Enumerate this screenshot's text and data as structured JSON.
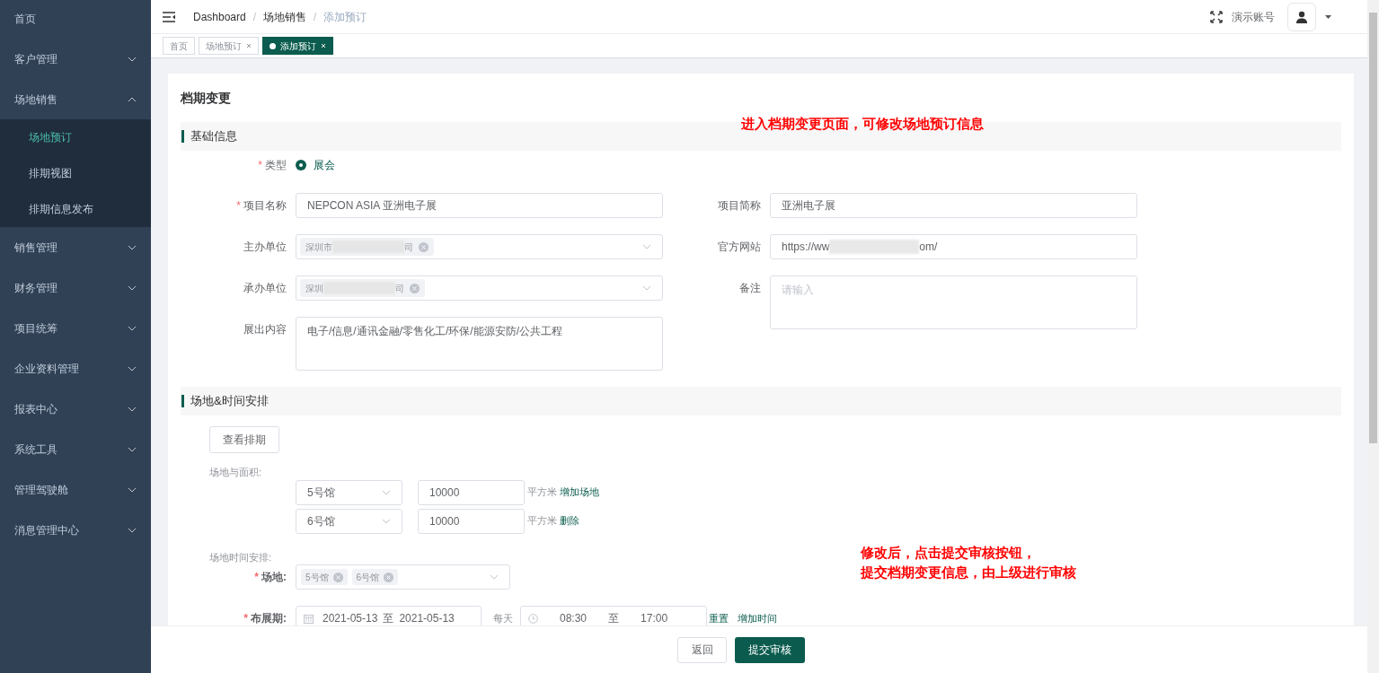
{
  "sidebar": {
    "items": [
      {
        "label": "首页"
      },
      {
        "label": "客户管理",
        "expandable": true,
        "expanded": false
      },
      {
        "label": "场地销售",
        "expandable": true,
        "expanded": true,
        "children": [
          {
            "label": "场地预订",
            "selected": true
          },
          {
            "label": "排期视图",
            "selected": false
          },
          {
            "label": "排期信息发布",
            "selected": false
          }
        ]
      },
      {
        "label": "销售管理",
        "expandable": true,
        "expanded": false
      },
      {
        "label": "财务管理",
        "expandable": true,
        "expanded": false
      },
      {
        "label": "项目统筹",
        "expandable": true,
        "expanded": false
      },
      {
        "label": "企业资料管理",
        "expandable": true,
        "expanded": false
      },
      {
        "label": "报表中心",
        "expandable": true,
        "expanded": false
      },
      {
        "label": "系统工具",
        "expandable": true,
        "expanded": false
      },
      {
        "label": "管理驾驶舱",
        "expandable": true,
        "expanded": false
      },
      {
        "label": "消息管理中心",
        "expandable": true,
        "expanded": false
      }
    ]
  },
  "header": {
    "breadcrumb": [
      {
        "label": "Dashboard",
        "current": false
      },
      {
        "separator": "/",
        "label": "场地销售",
        "current": false
      },
      {
        "separator": "/",
        "label": "添加预订",
        "current": true
      }
    ],
    "user": "演示账号"
  },
  "tabs": [
    {
      "label": "首页",
      "selected": false,
      "closable": false
    },
    {
      "label": "场地预订",
      "selected": false,
      "closable": true
    },
    {
      "label": "添加预订",
      "selected": true,
      "closable": true
    }
  ],
  "page_title": "档期变更",
  "basic_info": {
    "title": "基础信息",
    "type_field": {
      "label": "类型",
      "required_mark": "*",
      "option": {
        "label": "展会",
        "selected": true
      }
    },
    "left_fields": [
      {
        "kind": "input",
        "label": "项目名称",
        "required_mark": "*",
        "value": "NEPCON ASIA 亚洲电子展"
      },
      {
        "kind": "tag_select",
        "label": "主办单位",
        "tag": {
          "text_start": "深圳市",
          "text_end": "司"
        }
      },
      {
        "kind": "tag_select",
        "label": "承办单位",
        "tag": {
          "text_start": "深圳",
          "text_end": "司"
        }
      },
      {
        "kind": "textarea",
        "label": "展出内容",
        "value": "电子/信息/通讯金融/零售化工/环保/能源安防/公共工程"
      }
    ],
    "right_fields": [
      {
        "kind": "input",
        "label": "项目简称",
        "value": "亚洲电子展"
      },
      {
        "kind": "redacted_input",
        "label": "官方网站",
        "value_start": "https://ww",
        "value_end": "om/"
      },
      {
        "kind": "textarea",
        "label": "备注",
        "placeholder": "请输入"
      }
    ]
  },
  "venue_section": {
    "title": "场地&时间安排",
    "view_button": "查看排期",
    "area_label": "场地与面积:",
    "area_rows": [
      {
        "hall": "5号馆",
        "area": "10000",
        "unit": "平方米",
        "action": "增加场地"
      },
      {
        "hall": "6号馆",
        "area": "10000",
        "unit": "平方米",
        "action": "删除"
      }
    ],
    "schedule_label": "场地时间安排:",
    "venue_field": {
      "label": "场地:",
      "required_mark": "*",
      "tags": [
        "5号馆",
        "6号馆"
      ]
    },
    "setup_field": {
      "label": "布展期:",
      "required_mark": "*",
      "date_start": "2021-05-13",
      "date_sep": "至",
      "date_end": "2021-05-13",
      "daily": "每天",
      "time_start": "08:30",
      "time_sep": "至",
      "time_end": "17:00",
      "actions": [
        "重置",
        "增加时间"
      ]
    }
  },
  "footer_buttons": [
    {
      "label": "返回",
      "kind": "default"
    },
    {
      "label": "提交审核",
      "kind": "primary"
    }
  ],
  "annotations": [
    {
      "lines": [
        "进入档期变更页面，可修改场地预订信息"
      ]
    },
    {
      "lines": [
        "修改后，点击提交审核按钮，",
        "提交档期变更信息，由上级进行审核"
      ]
    }
  ]
}
